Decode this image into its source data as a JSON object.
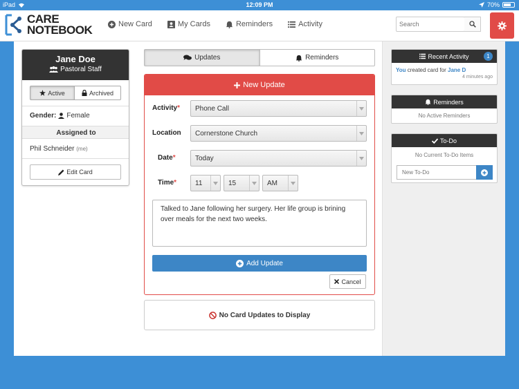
{
  "statusbar": {
    "device": "iPad",
    "time": "12:09 PM",
    "battery": "70%",
    "battery_level": 0.7
  },
  "logo": {
    "line1": "CARE",
    "line2": "NOTEBOOK"
  },
  "nav": {
    "items": [
      {
        "label": "New Card",
        "icon": "plus-circle-icon"
      },
      {
        "label": "My Cards",
        "icon": "id-card-icon"
      },
      {
        "label": "Reminders",
        "icon": "bell-icon"
      },
      {
        "label": "Activity",
        "icon": "list-icon"
      }
    ],
    "search_placeholder": "Search"
  },
  "profile": {
    "name": "Jane Doe",
    "role": "Pastoral Staff",
    "status_active": "Active",
    "status_archived": "Archived",
    "gender_label": "Gender:",
    "gender_value": "Female",
    "assigned_heading": "Assigned to",
    "assigned_name": "Phil Schneider",
    "assigned_me": "(me)",
    "edit_label": "Edit Card"
  },
  "tabs": {
    "updates": "Updates",
    "reminders": "Reminders"
  },
  "form": {
    "header": "New Update",
    "activity_label": "Activity",
    "activity_value": "Phone Call",
    "location_label": "Location",
    "location_value": "Cornerstone Church",
    "date_label": "Date",
    "date_value": "Today",
    "time_label": "Time",
    "hour_value": "11",
    "minute_value": "15",
    "ampm_value": "AM",
    "required_mark": "*",
    "note": "Talked to Jane following her surgery. Her life group is brining over meals for the next two weeks.",
    "submit_label": "Add Update",
    "cancel_label": "Cancel"
  },
  "empty_state": "No Card Updates to Display",
  "right": {
    "recent_activity_title": "Recent Activity",
    "recent_activity_count": "1",
    "activity_actor": "You",
    "activity_text": "created card for",
    "activity_target": "Jane D",
    "activity_time": "4 minutes ago",
    "reminders_title": "Reminders",
    "reminders_empty": "No Active Reminders",
    "todo_title": "To-Do",
    "todo_empty": "No Current To-Do Items",
    "todo_placeholder": "New To-Do"
  },
  "colors": {
    "brand_blue": "#3d8fd6",
    "accent_red": "#e14b47",
    "button_blue": "#3d86c6",
    "header_dark": "#333333"
  }
}
